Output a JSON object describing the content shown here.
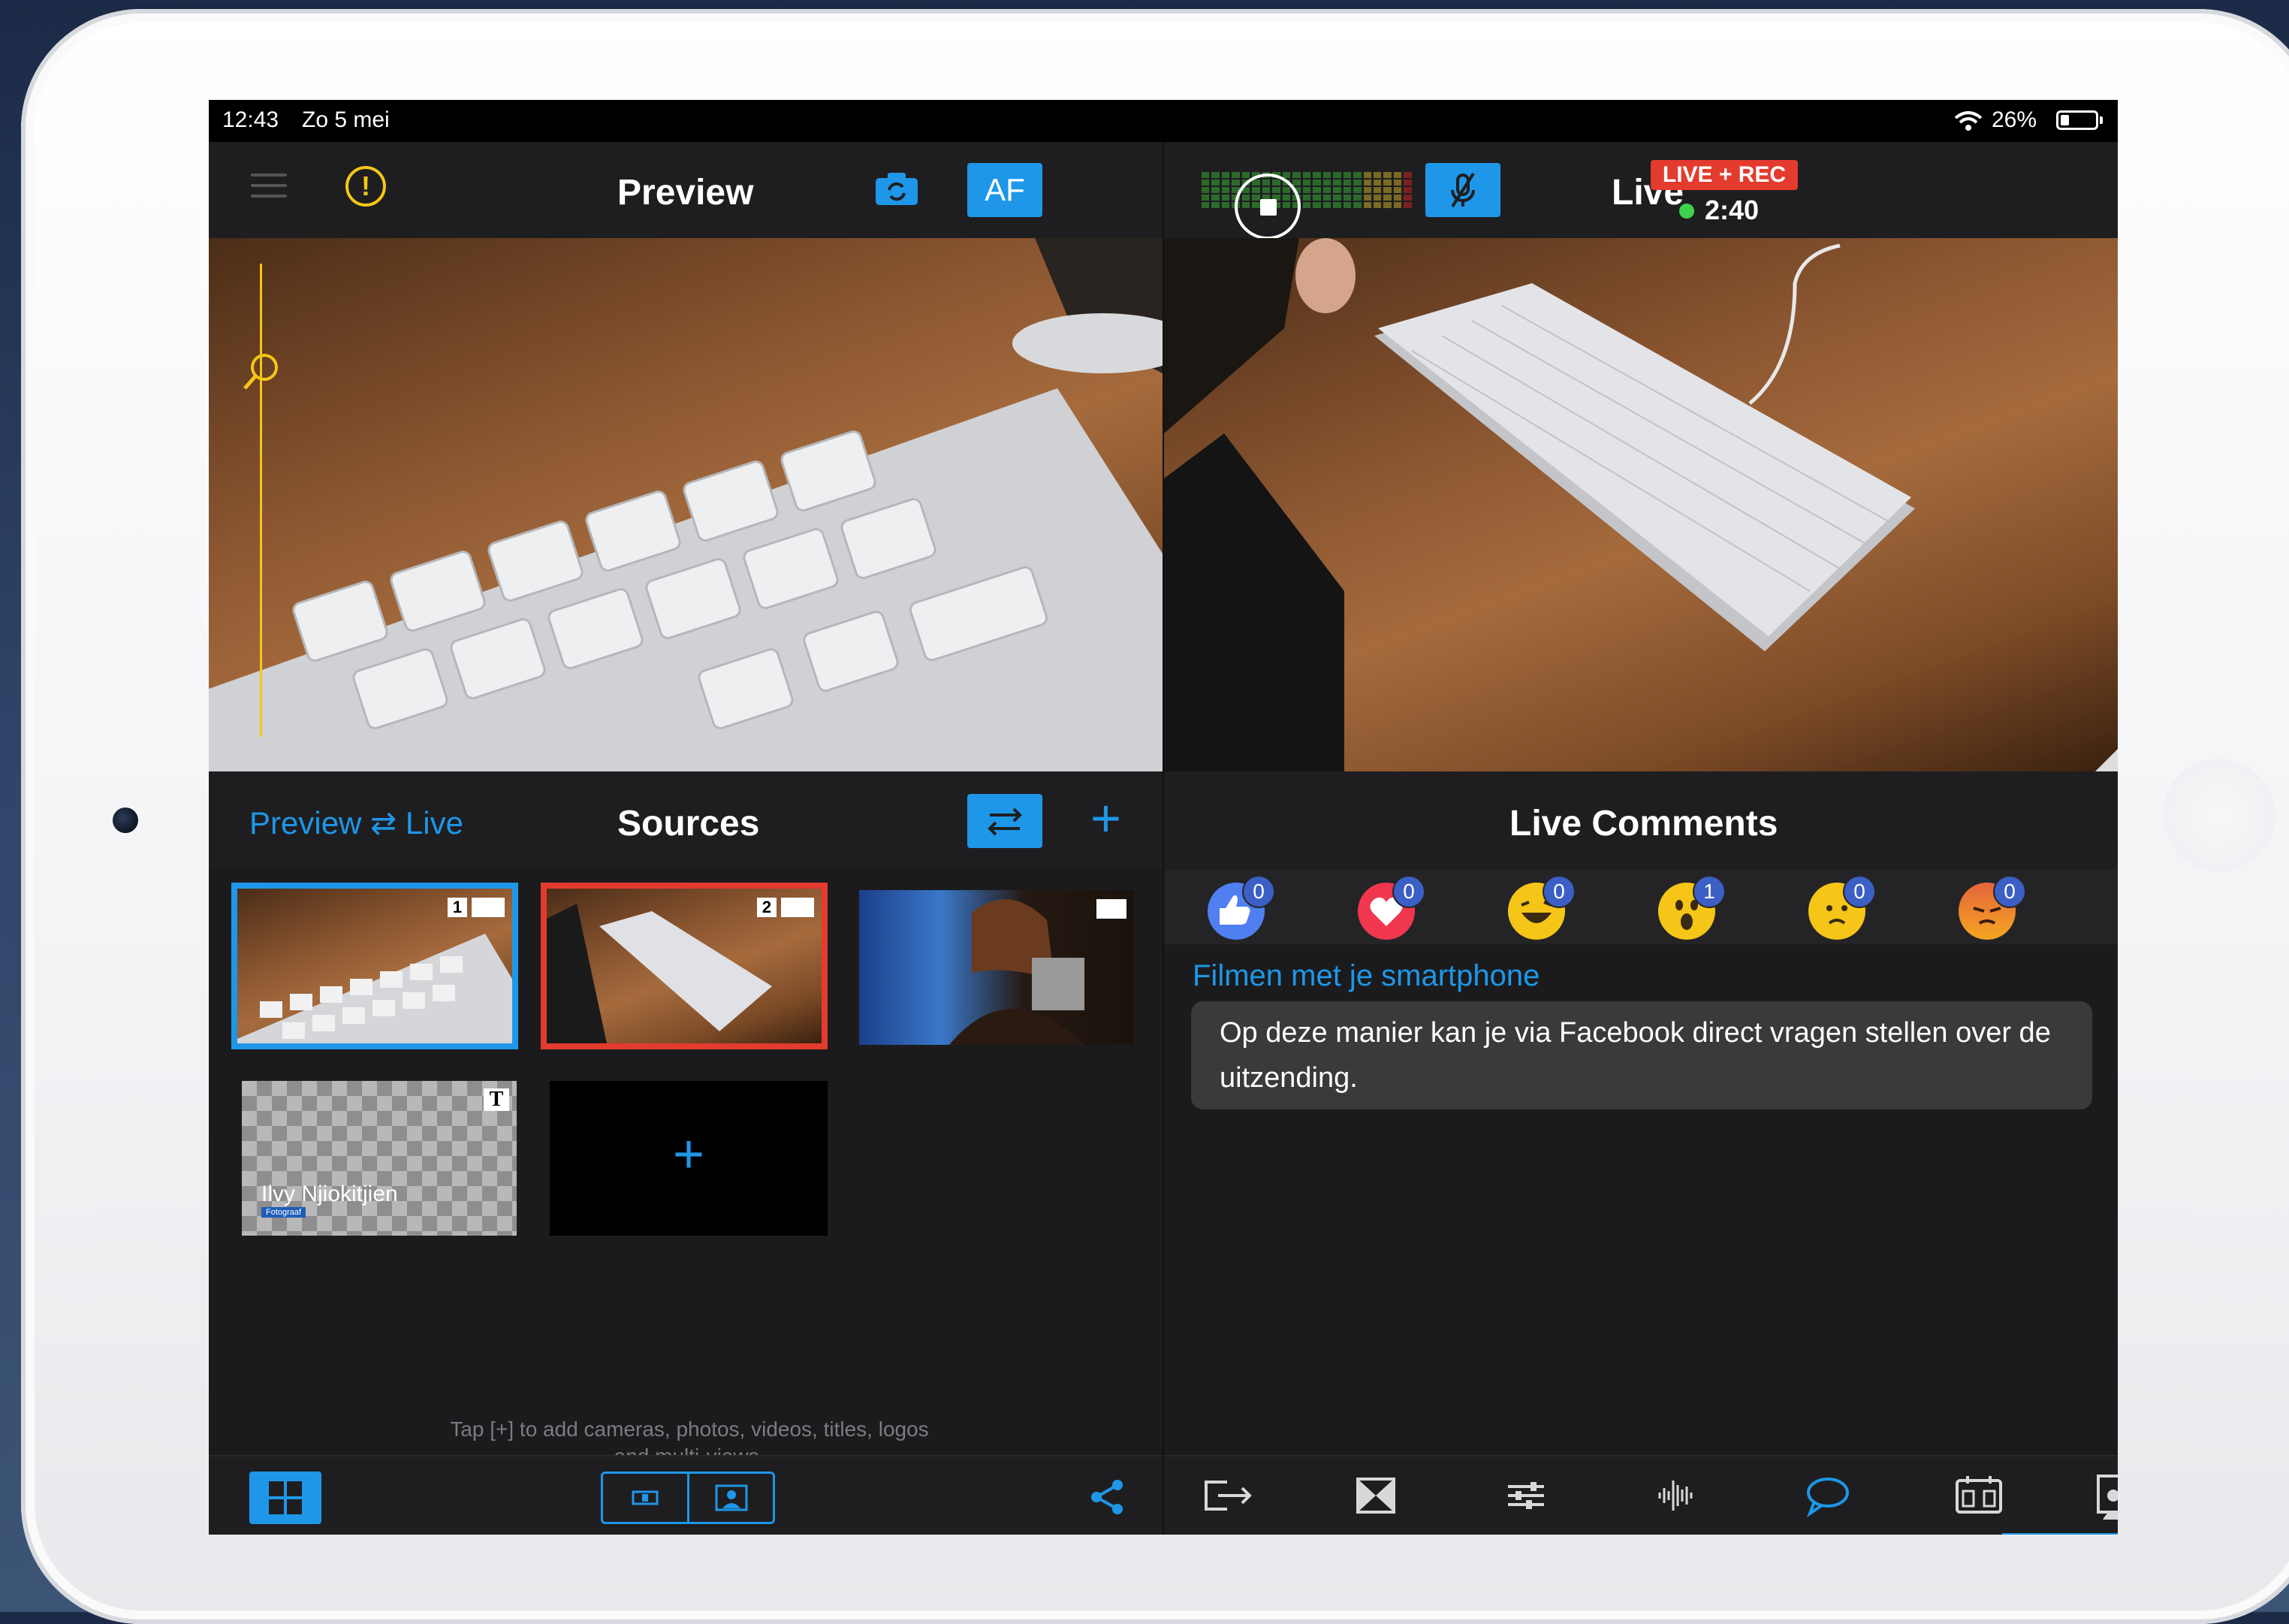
{
  "status": {
    "time": "12:43",
    "date": "Zo 5 mei",
    "battery": "26%",
    "battery_level": 0.26
  },
  "preview": {
    "title": "Preview",
    "af_label": "AF"
  },
  "live": {
    "title": "Live",
    "badge": "LIVE + REC",
    "timer": "2:40"
  },
  "sources": {
    "title": "Sources",
    "preview_live_link": "Preview ⇄ Live",
    "add_label": "+",
    "tiles": [
      {
        "number": "1",
        "type": "camera"
      },
      {
        "number": "2",
        "type": "camera"
      },
      {
        "type": "image"
      },
      {
        "type": "title",
        "title_text": "Ilvy Njiokitjien",
        "subtitle": "Fotograaf",
        "badge": "T"
      }
    ],
    "add_tile_label": "+",
    "hint": "Tap [+] to add cameras, photos, videos, titles, logos and multi-views."
  },
  "comments": {
    "title": "Live Comments",
    "reactions": [
      {
        "name": "like",
        "count": "0",
        "color": "#4f7ff0"
      },
      {
        "name": "love",
        "count": "0",
        "color": "#f0374e"
      },
      {
        "name": "haha",
        "count": "0",
        "color": "#f5c518"
      },
      {
        "name": "wow",
        "count": "1",
        "color": "#f5c518"
      },
      {
        "name": "sad",
        "count": "0",
        "color": "#f5c518"
      },
      {
        "name": "angry",
        "count": "0",
        "color": "#e5643a"
      }
    ],
    "items": [
      {
        "author": "Filmen met je smartphone",
        "text": "Op deze manier kan je via Facebook direct vragen stellen over de uitzending."
      }
    ]
  },
  "colors": {
    "accent": "#1e97e8",
    "live_red": "#e33b2e",
    "warning": "#f5c518",
    "rec_dot": "#3ed34a"
  },
  "bottom_tabs": [
    "output-icon",
    "transition-icon",
    "sliders-icon",
    "audio-wave-icon",
    "comments-icon",
    "scoreboard-icon",
    "presenter-icon"
  ],
  "active_tab": "comments-icon"
}
